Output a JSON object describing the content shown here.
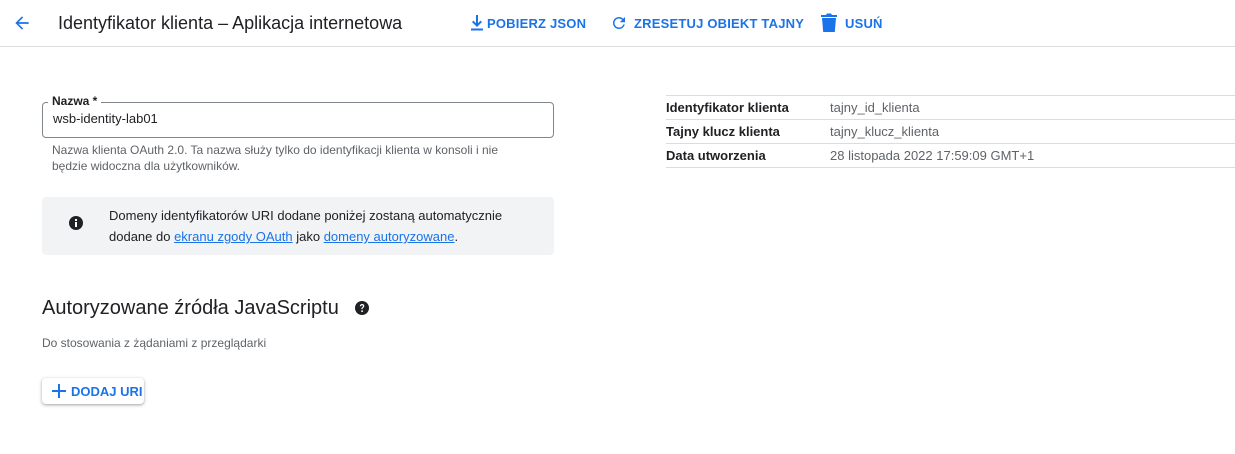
{
  "header": {
    "title": "Identyfikator klienta – Aplikacja internetowa",
    "back_icon": "arrow-back-icon",
    "actions": {
      "download": {
        "label": "POBIERZ JSON",
        "icon": "download-icon"
      },
      "reset": {
        "label": "ZRESETUJ OBIEKT TAJNY",
        "icon": "refresh-icon"
      },
      "delete": {
        "label": "USUŃ",
        "icon": "trash-icon"
      }
    }
  },
  "form": {
    "name": {
      "label": "Nazwa *",
      "value": "wsb-identity-lab01",
      "hint": "Nazwa klienta OAuth 2.0. Ta nazwa służy tylko do identyfikacji klienta w konsoli i nie będzie widoczna dla użytkowników."
    }
  },
  "info": {
    "icon": "info-icon",
    "text_before": "Domeny identyfikatorów URI dodane poniżej zostaną automatycznie dodane do ",
    "link1": "ekranu zgody OAuth",
    "text_mid": " jako ",
    "link2": "domeny autoryzowane",
    "text_after": "."
  },
  "js_origins": {
    "title": "Autoryzowane źródła JavaScriptu",
    "help_icon": "help-icon",
    "description": "Do stosowania z żądaniami z przeglądarki",
    "add_button": "DODAJ URI",
    "add_icon": "plus-icon"
  },
  "details": [
    {
      "key": "Identyfikator klienta",
      "value": "tajny_id_klienta"
    },
    {
      "key": "Tajny klucz klienta",
      "value": "tajny_klucz_klienta"
    },
    {
      "key": "Data utworzenia",
      "value": "28 listopada 2022 17:59:09 GMT+1"
    }
  ],
  "colors": {
    "accent": "#1a73e8",
    "text": "#202124",
    "muted": "#5f6368",
    "divider": "#dadce0",
    "banner_bg": "#f1f3f4"
  }
}
